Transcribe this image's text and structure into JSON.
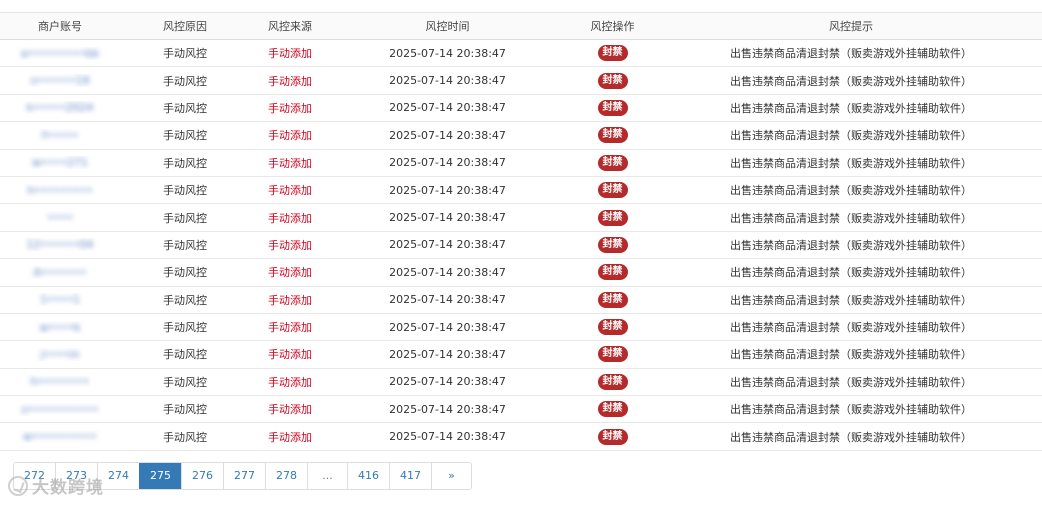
{
  "table": {
    "headers": [
      "商户账号",
      "风控原因",
      "风控来源",
      "风控时间",
      "风控操作",
      "风控提示"
    ],
    "rows": [
      {
        "account": "a•••••••••bk",
        "reason": "手动风控",
        "source": "手动添加",
        "time": "2025-07-14 20:38:47",
        "action": "封禁",
        "hint": "出售违禁商品清退封禁（贩卖游戏外挂辅助软件）"
      },
      {
        "account": "s••••••19",
        "reason": "手动风控",
        "source": "手动添加",
        "time": "2025-07-14 20:38:47",
        "action": "封禁",
        "hint": "出售违禁商品清退封禁（贩卖游戏外挂辅助软件）"
      },
      {
        "account": "k•••••2024",
        "reason": "手动风控",
        "source": "手动添加",
        "time": "2025-07-14 20:38:47",
        "action": "封禁",
        "hint": "出售违禁商品清退封禁（贩卖游戏外挂辅助软件）"
      },
      {
        "account": "f•••••",
        "reason": "手动风控",
        "source": "手动添加",
        "time": "2025-07-14 20:38:47",
        "action": "封禁",
        "hint": "出售违禁商品清退封禁（贩卖游戏外挂辅助软件）"
      },
      {
        "account": "w••••271",
        "reason": "手动风控",
        "source": "手动添加",
        "time": "2025-07-14 20:38:47",
        "action": "封禁",
        "hint": "出售违禁商品清退封禁（贩卖游戏外挂辅助软件）"
      },
      {
        "account": "h•••••••••",
        "reason": "手动风控",
        "source": "手动添加",
        "time": "2025-07-14 20:38:47",
        "action": "封禁",
        "hint": "出售违禁商品清退封禁（贩卖游戏外挂辅助软件）"
      },
      {
        "account": "••••",
        "reason": "手动风控",
        "source": "手动添加",
        "time": "2025-07-14 20:38:47",
        "action": "封禁",
        "hint": "出售违禁商品清退封禁（贩卖游戏外挂辅助软件）"
      },
      {
        "account": "12••••••04",
        "reason": "手动风控",
        "source": "手动添加",
        "time": "2025-07-14 20:38:47",
        "action": "封禁",
        "hint": "出售违禁商品清退封禁（贩卖游戏外挂辅助软件）"
      },
      {
        "account": "A•••••••",
        "reason": "手动风控",
        "source": "手动添加",
        "time": "2025-07-14 20:38:47",
        "action": "封禁",
        "hint": "出售违禁商品清退封禁（贩卖游戏外挂辅助软件）"
      },
      {
        "account": "1••••1",
        "reason": "手动风控",
        "source": "手动添加",
        "time": "2025-07-14 20:38:47",
        "action": "封禁",
        "hint": "出售违禁商品清退封禁（贩卖游戏外挂辅助软件）"
      },
      {
        "account": "w••••k",
        "reason": "手动风控",
        "source": "手动添加",
        "time": "2025-07-14 20:38:47",
        "action": "封禁",
        "hint": "出售违禁商品清退封禁（贩卖游戏外挂辅助软件）"
      },
      {
        "account": "j••••in",
        "reason": "手动风控",
        "source": "手动添加",
        "time": "2025-07-14 20:38:47",
        "action": "封禁",
        "hint": "出售违禁商品清退封禁（贩卖游戏外挂辅助软件）"
      },
      {
        "account": "h••••••••",
        "reason": "手动风控",
        "source": "手动添加",
        "time": "2025-07-14 20:38:47",
        "action": "封禁",
        "hint": "出售违禁商品清退封禁（贩卖游戏外挂辅助软件）"
      },
      {
        "account": "s•••••••••••",
        "reason": "手动风控",
        "source": "手动添加",
        "time": "2025-07-14 20:38:47",
        "action": "封禁",
        "hint": "出售违禁商品清退封禁（贩卖游戏外挂辅助软件）"
      },
      {
        "account": "w••••••••••",
        "reason": "手动风控",
        "source": "手动添加",
        "time": "2025-07-14 20:38:47",
        "action": "封禁",
        "hint": "出售违禁商品清退封禁（贩卖游戏外挂辅助软件）"
      }
    ]
  },
  "pagination": {
    "pages": [
      "272",
      "273",
      "274",
      "275",
      "276",
      "277",
      "278",
      "...",
      "416",
      "417",
      "»"
    ],
    "active": "275"
  },
  "colors": {
    "source_text": "#d0021b",
    "badge_bg": "#b52a2a",
    "active_page": "#337ab7",
    "link": "#337ab7"
  },
  "watermark": {
    "text": "大数跨境",
    "icon": "logo-icon"
  }
}
